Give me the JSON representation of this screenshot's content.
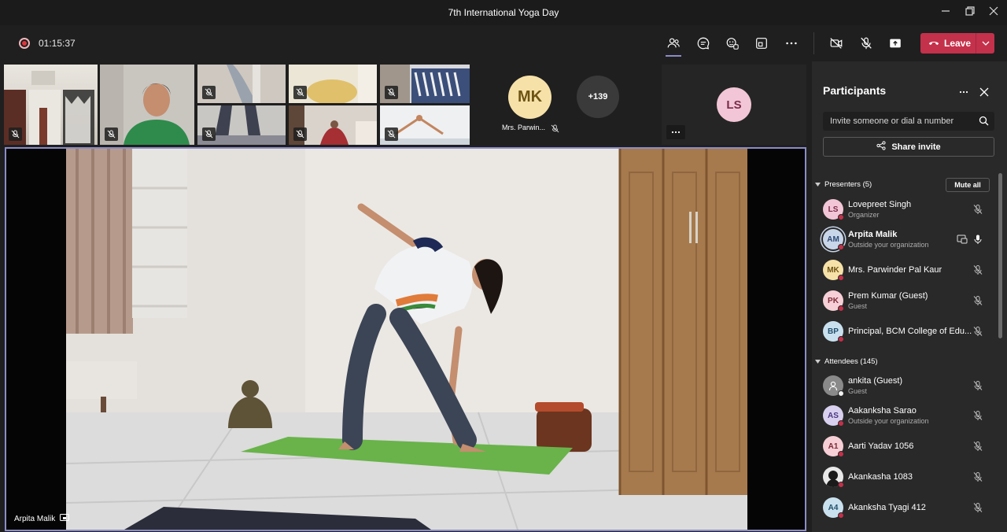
{
  "window": {
    "title": "7th International Yoga Day"
  },
  "toolbar": {
    "timer": "01:15:37",
    "leave_label": "Leave"
  },
  "gallery": {
    "featured_tile_name": "Mrs. Parwin...",
    "featured_initials": "MK",
    "overflow_count": "+139",
    "ls_initials": "LS",
    "more_label": "..."
  },
  "main_video": {
    "speaker_name": "Arpita Malik"
  },
  "participants_panel": {
    "title": "Participants",
    "search_placeholder": "Invite someone or dial a number",
    "share_label": "Share invite",
    "presenters_header": "Presenters (5)",
    "mute_all_label": "Mute all",
    "attendees_header": "Attendees (145)",
    "presenters": [
      {
        "initials": "LS",
        "name": "Lovepreet Singh",
        "role": "Organizer",
        "color": "#f2c6d6",
        "text": "#7a2c49"
      },
      {
        "initials": "AM",
        "name": "Arpita Malik",
        "role": "Outside your organization",
        "color": "#c9d5e8",
        "text": "#2d4a74"
      },
      {
        "initials": "MK",
        "name": "Mrs. Parwinder Pal Kaur",
        "role": "",
        "color": "#f6e1a8",
        "text": "#6e5414"
      },
      {
        "initials": "PK",
        "name": "Prem Kumar (Guest)",
        "role": "Guest",
        "color": "#f7cfd6",
        "text": "#7d2a38"
      },
      {
        "initials": "BP",
        "name": "Principal, BCM College of Edu...",
        "role": "",
        "color": "#c9e1ef",
        "text": "#23506b"
      }
    ],
    "attendees": [
      {
        "initials": "",
        "name": "ankita (Guest)",
        "role": "Guest",
        "color": "#8a8a8a",
        "text": "#fff"
      },
      {
        "initials": "AS",
        "name": "Aakanksha Sarao",
        "role": "Outside your organization",
        "color": "#d9d0ef",
        "text": "#4a3880"
      },
      {
        "initials": "A1",
        "name": "Aarti Yadav 1056",
        "role": "",
        "color": "#f7cfd6",
        "text": "#7d2a38"
      },
      {
        "initials": "",
        "name": "Akankasha 1083",
        "role": "",
        "color": "#3a3a3a",
        "text": "#fff"
      },
      {
        "initials": "A4",
        "name": "Akanksha Tyagi 412",
        "role": "",
        "color": "#c9e1ef",
        "text": "#23506b"
      }
    ]
  },
  "colors": {
    "accent": "#8b8cc7",
    "leave": "#c4314b",
    "panel_bg": "#292929",
    "app_bg": "#1f1f1f"
  }
}
